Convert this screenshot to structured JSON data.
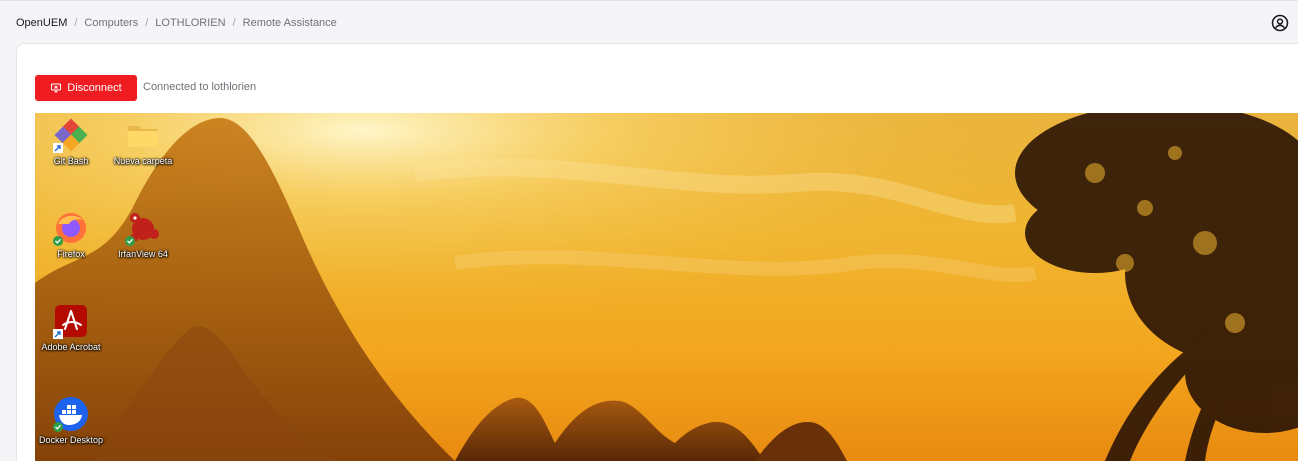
{
  "breadcrumb": {
    "items": [
      "OpenUEM",
      "Computers",
      "LOTHLORIEN",
      "Remote Assistance"
    ],
    "separator": "/"
  },
  "header": {
    "user_icon": "user-circle-icon"
  },
  "toolbar": {
    "disconnect_label": "Disconnect",
    "disconnect_icon": "monitor-off-icon",
    "status_text": "Connected to lothlorien",
    "accent_color": "#ef1c22"
  },
  "remote_desktop": {
    "wallpaper": "sunset-karst-mountains",
    "icons": [
      {
        "label": "Git Bash",
        "icon": "git-bash-icon",
        "badge": "shortcut-arrow"
      },
      {
        "label": "Nueva carpeta",
        "icon": "folder-icon",
        "badge": ""
      },
      {
        "label": "Firefox",
        "icon": "firefox-icon",
        "badge": "check"
      },
      {
        "label": "IrfanView 64",
        "icon": "irfanview-icon",
        "badge": "check"
      },
      {
        "label": "Adobe Acrobat",
        "icon": "acrobat-icon",
        "badge": "shortcut-arrow"
      },
      {
        "label": "Docker Desktop",
        "icon": "docker-icon",
        "badge": "check"
      }
    ]
  }
}
